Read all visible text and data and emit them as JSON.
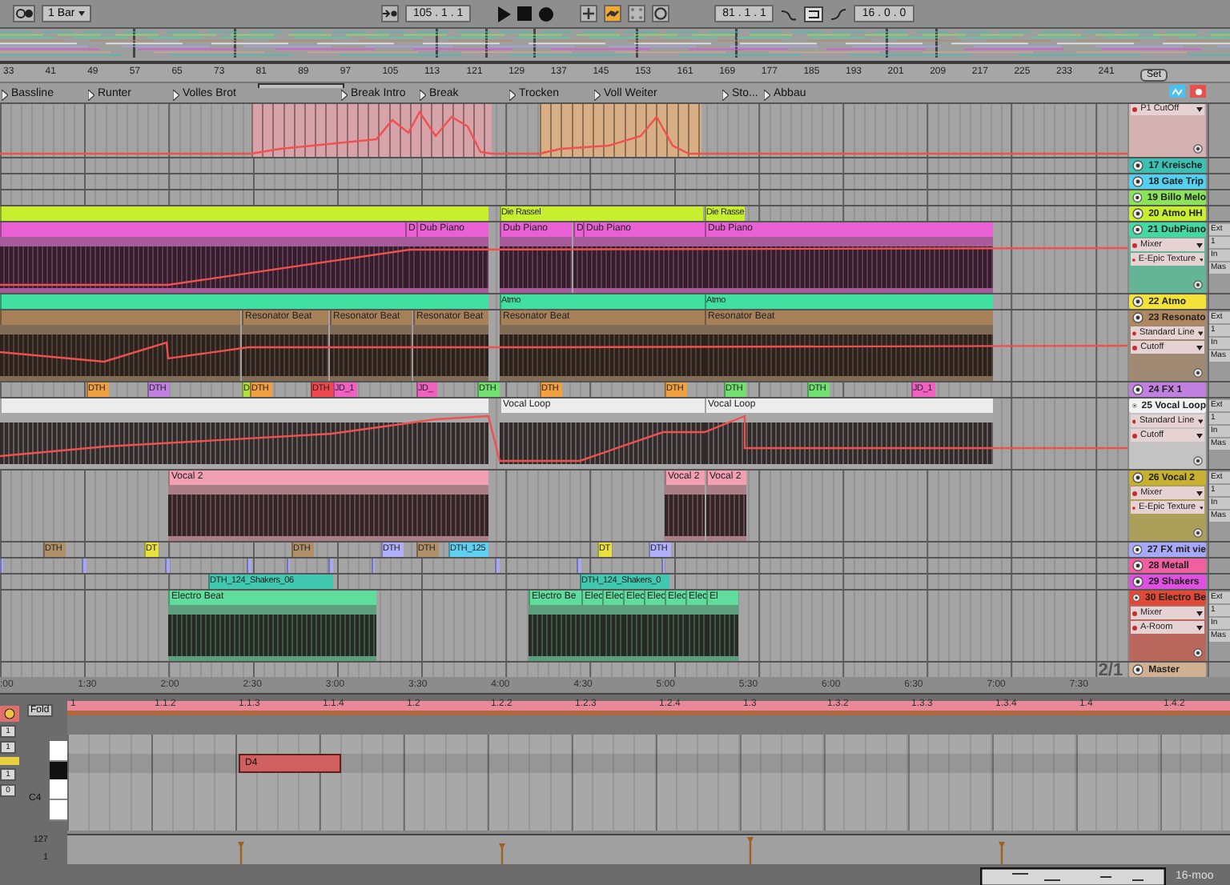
{
  "toolbar": {
    "quantize": "1 Bar",
    "position": "105 . 1 . 1",
    "loop_start": "81 . 1 . 1",
    "loop_length": "16 . 0 . 0",
    "buttons": [
      {
        "kind": "add",
        "on": false
      },
      {
        "kind": "link",
        "on": true
      },
      {
        "kind": "dots",
        "on": false
      },
      {
        "kind": "ring",
        "on": false
      }
    ]
  },
  "bar_ruler": [
    "33",
    "41",
    "49",
    "57",
    "65",
    "73",
    "81",
    "89",
    "97",
    "105",
    "113",
    "121",
    "129",
    "137",
    "145",
    "153",
    "161",
    "169",
    "177",
    "185",
    "193",
    "201",
    "209",
    "217",
    "225",
    "233",
    "241"
  ],
  "locators": [
    {
      "label": "Bassline"
    },
    {
      "label": "Runter"
    },
    {
      "label": "Volles Brot"
    },
    {
      "label": "Break Intro"
    },
    {
      "label": "Break"
    },
    {
      "label": "Trocken"
    },
    {
      "label": "Voll Weiter"
    },
    {
      "label": "Sto..."
    },
    {
      "label": "Abbau"
    }
  ],
  "set_button": "Set",
  "tracks": [
    {
      "kind": "expanded",
      "color": "#d4b2b2",
      "dropdowns": [
        "P1 CutOff"
      ],
      "clips": [
        {
          "color": "#d7a3a8"
        },
        {
          "color": "#d8ae84"
        }
      ]
    },
    {
      "kind": "collapsed",
      "name": "17 Kreische",
      "color": "#3cc0b4"
    },
    {
      "kind": "collapsed",
      "name": "18 Gate Trip",
      "color": "#52d0ee"
    },
    {
      "kind": "collapsed",
      "name": "19 Billo Melo",
      "color": "#8ae35a"
    },
    {
      "kind": "collapsed",
      "name": "20 Atmo HH",
      "color": "#c8ee30",
      "clips": [
        {
          "color": "#c8ee30"
        },
        {
          "label": "Die Rassel",
          "color": "#c8ee30"
        },
        {
          "label": "Die Rasse",
          "color": "#c8ee30"
        }
      ]
    },
    {
      "kind": "expanded",
      "name": "21 DubPiano",
      "color": "#44d9a2",
      "dropdowns": [
        "Mixer",
        "E-Epic Texture"
      ],
      "io": [
        "Ext",
        "1",
        "In",
        "Mas"
      ],
      "clips": [
        {
          "color": "#e860d4"
        },
        {
          "label": "D",
          "color": "#e860d4"
        },
        {
          "label": "Dub Piano",
          "color": "#e860d4"
        },
        {
          "label": "Dub Piano",
          "color": "#e860d4"
        },
        {
          "label": "D",
          "color": "#e860d4"
        },
        {
          "label": "Dub Piano",
          "color": "#e860d4"
        },
        {
          "label": "Dub Piano",
          "color": "#e860d4"
        }
      ]
    },
    {
      "kind": "collapsed",
      "name": "22 Atmo",
      "color": "#f2e23a",
      "clips": [
        {
          "color": "#40e0a0"
        },
        {
          "label": "Atmo",
          "color": "#40e0a0"
        },
        {
          "label": "Atmo",
          "color": "#40e0a0"
        }
      ]
    },
    {
      "kind": "expanded",
      "name": "23 Resonato",
      "color": "#b08860",
      "dropdowns": [
        "Standard Line",
        "Cutoff"
      ],
      "io": [
        "Ext",
        "1",
        "In",
        "Mas"
      ],
      "clips": [
        {
          "color": "#a58058"
        },
        {
          "label": "Resonator Beat",
          "color": "#a58058"
        },
        {
          "label": "Resonator Beat",
          "color": "#a58058"
        },
        {
          "label": "Resonator Beat",
          "color": "#a58058"
        },
        {
          "label": "Resonator Beat",
          "color": "#a58058"
        },
        {
          "label": "Resonator Beat",
          "color": "#a58058"
        }
      ]
    },
    {
      "kind": "collapsed",
      "name": "24 FX 1",
      "color": "#c080e0",
      "clips": [
        {
          "label": "DTH",
          "color": "#f0a040"
        },
        {
          "label": "DTH",
          "color": "#c080e0"
        },
        {
          "label": "D",
          "color": "#b0e040"
        },
        {
          "label": "DTH",
          "color": "#f0a040"
        },
        {
          "label": "DTH",
          "color": "#f04850"
        },
        {
          "label": "JD_1",
          "color": "#f060c0"
        },
        {
          "label": "JD_",
          "color": "#f060c0"
        },
        {
          "label": "DTH",
          "color": "#70e070"
        },
        {
          "label": "DTH",
          "color": "#f0a040"
        },
        {
          "label": "DTH",
          "color": "#f0a040"
        },
        {
          "label": "DTH",
          "color": "#70e070"
        },
        {
          "label": "DTH",
          "color": "#70e070"
        },
        {
          "label": "JD_1",
          "color": "#f060c0"
        }
      ]
    },
    {
      "kind": "expanded",
      "name": "25 Vocal Loop",
      "color": "#f2f2f2",
      "dropdowns": [
        "Standard Line",
        "Cutoff"
      ],
      "io": [
        "Ext",
        "1",
        "In",
        "Mas"
      ],
      "clips": [
        {
          "color": "#ececec"
        },
        {
          "label": "Vocal Loop",
          "color": "#ececec"
        },
        {
          "label": "Vocal Loop",
          "color": "#ececec"
        }
      ]
    },
    {
      "kind": "expanded",
      "name": "26 Vocal 2",
      "color": "#c8b030",
      "dropdowns": [
        "Mixer",
        "E-Epic Texture"
      ],
      "io": [
        "Ext",
        "1",
        "In",
        "Mas"
      ],
      "clips": [
        {
          "label": "Vocal 2",
          "color": "#f0a0b0"
        },
        {
          "label": "Vocal 2",
          "color": "#f0a0b0"
        },
        {
          "label": "Vocal 2",
          "color": "#f0a0b0"
        }
      ]
    },
    {
      "kind": "collapsed",
      "name": "27 FX mit vie",
      "color": "#a8a8f8",
      "clips": [
        {
          "label": "DTH",
          "color": "#b09068"
        },
        {
          "label": "DT",
          "color": "#e8e040"
        },
        {
          "label": "DTH",
          "color": "#b09068"
        },
        {
          "label": "DTH",
          "color": "#b0b0f8"
        },
        {
          "label": "DTH",
          "color": "#b09068"
        },
        {
          "label": "DTH_125",
          "color": "#60d0f0"
        },
        {
          "label": "DT",
          "color": "#e8e040"
        },
        {
          "label": "DTH",
          "color": "#b0b0f8"
        }
      ]
    },
    {
      "kind": "collapsed",
      "name": "28 Metall",
      "color": "#f060a0",
      "clips": [
        {
          "color": "#a8a8f0"
        },
        {
          "color": "#a8a8f0"
        },
        {
          "color": "#a8a8f0"
        },
        {
          "color": "#a8a8f0"
        },
        {
          "color": "#a8a8f0"
        },
        {
          "color": "#a8a8f0"
        },
        {
          "color": "#a8a8f0"
        },
        {
          "color": "#a8a8f0"
        },
        {
          "color": "#a8a8f0"
        },
        {
          "color": "#a8a8f0"
        }
      ]
    },
    {
      "kind": "collapsed",
      "name": "29 Shakers",
      "color": "#e050e0",
      "clips": [
        {
          "label": "DTH_124_Shakers_06",
          "color": "#40c8b0"
        },
        {
          "label": "DTH_124_Shakers_0",
          "color": "#40c8b0"
        }
      ]
    },
    {
      "kind": "expanded",
      "name": "30 Electro Be",
      "color": "#e04838",
      "dropdowns": [
        "Mixer",
        "A-Room"
      ],
      "io": [
        "Ext",
        "1",
        "In",
        "Mas"
      ],
      "clips": [
        {
          "label": "Electro Beat",
          "color": "#60dc9c"
        },
        {
          "label": "Electro Be",
          "color": "#60dc9c"
        },
        {
          "label": "Elec",
          "color": "#60dc9c"
        },
        {
          "label": "Elec",
          "color": "#60dc9c"
        },
        {
          "label": "Elec",
          "color": "#60dc9c"
        },
        {
          "label": "Elec",
          "color": "#60dc9c"
        },
        {
          "label": "Elec",
          "color": "#60dc9c"
        },
        {
          "label": "Elec",
          "color": "#60dc9c"
        },
        {
          "label": "El",
          "color": "#60dc9c"
        }
      ]
    },
    {
      "kind": "collapsed",
      "name": "Master",
      "color": "#d0b090",
      "overlay_text": "2/1"
    }
  ],
  "time_ruler": [
    ":00",
    "1:30",
    "2:00",
    "2:30",
    "3:00",
    "3:30",
    "4:00",
    "4:30",
    "5:00",
    "5:30",
    "6:00",
    "6:30",
    "7:00",
    "7:30"
  ],
  "clip_view": {
    "fold_button": "Fold",
    "values": [
      "1",
      "1",
      "1",
      "0"
    ],
    "key_label": "C4",
    "ruler": [
      "1",
      "1.1.2",
      "1.1.3",
      "1.1.4",
      "1.2",
      "1.2.2",
      "1.2.3",
      "1.2.4",
      "1.3",
      "1.3.2",
      "1.3.3",
      "1.3.4",
      "1.4",
      "1.4.2"
    ],
    "note": "D4",
    "velocity_max": "127",
    "velocity_min": "1"
  },
  "status_text": "16-moo"
}
